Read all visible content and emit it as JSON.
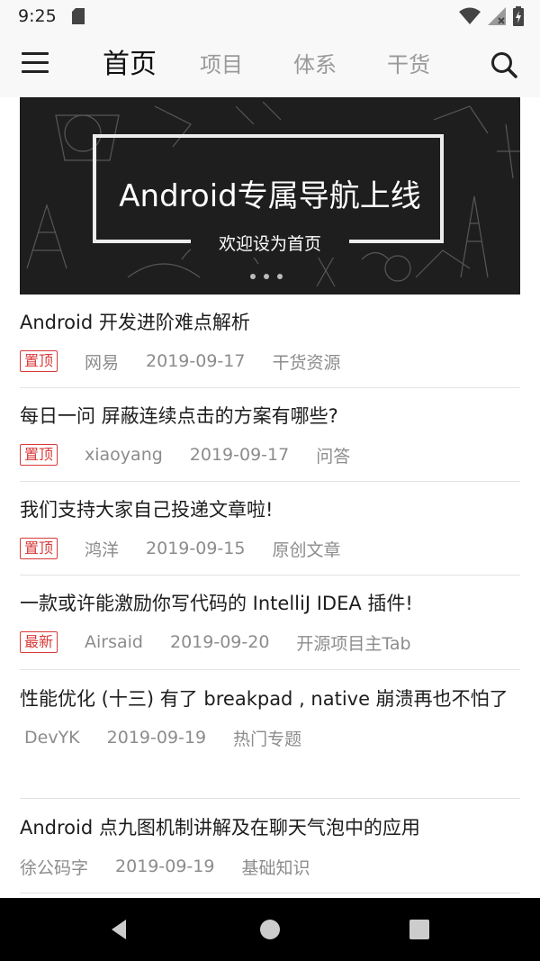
{
  "status_bar": {
    "time": "9:25"
  },
  "app_bar": {
    "tabs": [
      {
        "label": "首页",
        "active": true
      },
      {
        "label": "项目",
        "active": false
      },
      {
        "label": "体系",
        "active": false
      },
      {
        "label": "干货",
        "active": false
      }
    ]
  },
  "banner": {
    "title": "Android专属导航上线",
    "subtitle": "欢迎设为首页"
  },
  "articles": [
    {
      "title": "Android 开发进阶难点解析",
      "tag": "置顶",
      "author": "网易",
      "date": "2019-09-17",
      "category": "干货资源"
    },
    {
      "title": "每日一问 屏蔽连续点击的方案有哪些?",
      "tag": "置顶",
      "author": "xiaoyang",
      "date": "2019-09-17",
      "category": "问答"
    },
    {
      "title": "我们支持大家自己投递文章啦!",
      "tag": "置顶",
      "author": "鸿洋",
      "date": "2019-09-15",
      "category": "原创文章"
    },
    {
      "title": "一款或许能激励你写代码的 IntelliJ IDEA 插件!",
      "tag": "最新",
      "author": "Airsaid",
      "date": "2019-09-20",
      "category": "开源项目主Tab"
    },
    {
      "title": "性能优化 (十三) 有了 breakpad , native 崩溃再也不怕了",
      "tag": "",
      "author": "DevYK",
      "date": "2019-09-19",
      "category": "热门专题"
    },
    {
      "title": "Android 点九图机制讲解及在聊天气泡中的应用",
      "tag": "",
      "author": "徐公码字",
      "date": "2019-09-19",
      "category": "基础知识"
    }
  ],
  "colors": {
    "tag_red": "#d93a3a",
    "status_bar_bg": "#f8f8f8",
    "nav_bar_bg": "#000000"
  },
  "icons": {
    "status": [
      "sd-card-icon",
      "wifi-icon",
      "signal-icon",
      "battery-icon"
    ],
    "app_bar": [
      "menu-icon",
      "search-icon"
    ],
    "nav": [
      "back-icon",
      "home-icon",
      "recents-icon"
    ]
  }
}
